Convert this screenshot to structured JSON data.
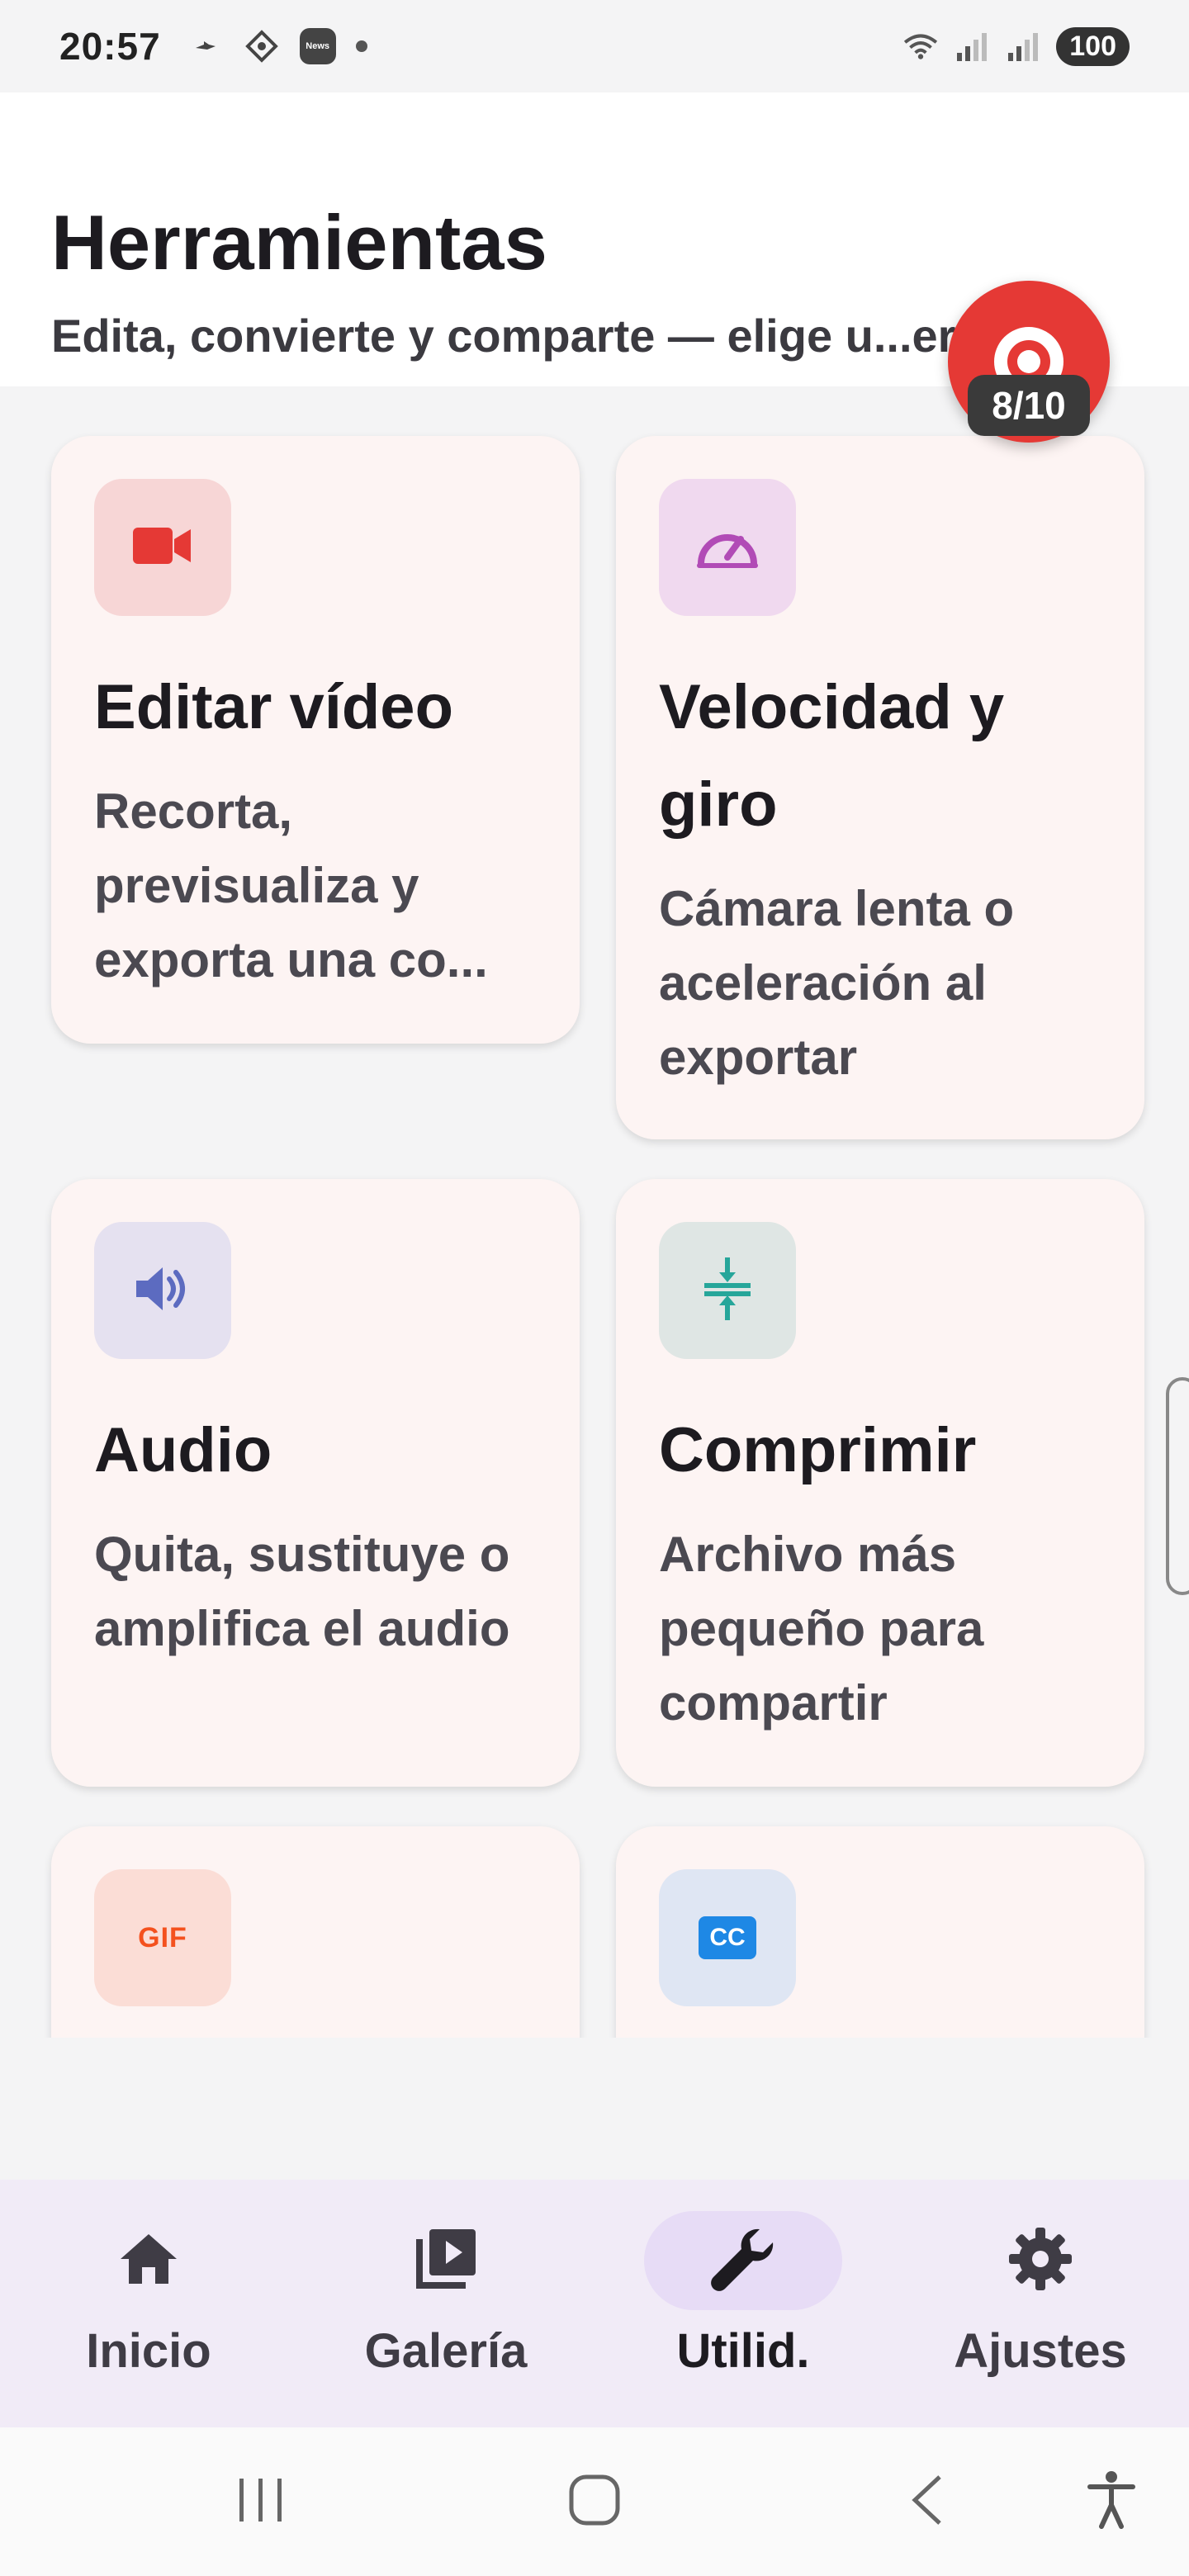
{
  "status_bar": {
    "time": "20:57",
    "battery": "100"
  },
  "header": {
    "title": "Herramientas",
    "subtitle": "Edita, convierte y comparte — elige u...err..."
  },
  "record_overlay": {
    "count": "8/10"
  },
  "cards": [
    {
      "title": "Editar vídeo",
      "description": "Recorta, previsualiza y exporta una co...",
      "icon": "video-camera-icon",
      "tile_color": "#f7d6d6",
      "icon_color": "#e53935"
    },
    {
      "title": "Velocidad y giro",
      "description": "Cámara lenta o aceleración al exportar",
      "icon": "speedometer-icon",
      "tile_color": "#f0d9ef",
      "icon_color": "#b14bb6"
    },
    {
      "title": "Audio",
      "description": "Quita, sustituye o amplifica el audio",
      "icon": "volume-icon",
      "tile_color": "#e5e1f0",
      "icon_color": "#5c6bc0"
    },
    {
      "title": "Comprimir",
      "description": "Archivo más pequeño para compartir",
      "icon": "compress-icon",
      "tile_color": "#dfe6e4",
      "icon_color": "#26a69a"
    },
    {
      "title": "",
      "description": "",
      "icon": "gif-icon",
      "icon_text": "GIF",
      "tile_color": "#fbddd6",
      "icon_color": "#f4511e"
    },
    {
      "title": "",
      "description": "",
      "icon": "closed-captions-icon",
      "icon_text": "CC",
      "tile_color": "#dfe6f3",
      "icon_color": "#1e88e5"
    }
  ],
  "bottom_nav": {
    "items": [
      {
        "label": "Inicio",
        "icon": "home-icon"
      },
      {
        "label": "Galería",
        "icon": "gallery-icon"
      },
      {
        "label": "Utilid.",
        "icon": "wrench-icon",
        "active": true
      },
      {
        "label": "Ajustes",
        "icon": "settings-gear-icon"
      }
    ]
  },
  "colors": {
    "accent": "#e7dcf6",
    "record": "#e53935",
    "card_bg": "#fdf4f3"
  }
}
